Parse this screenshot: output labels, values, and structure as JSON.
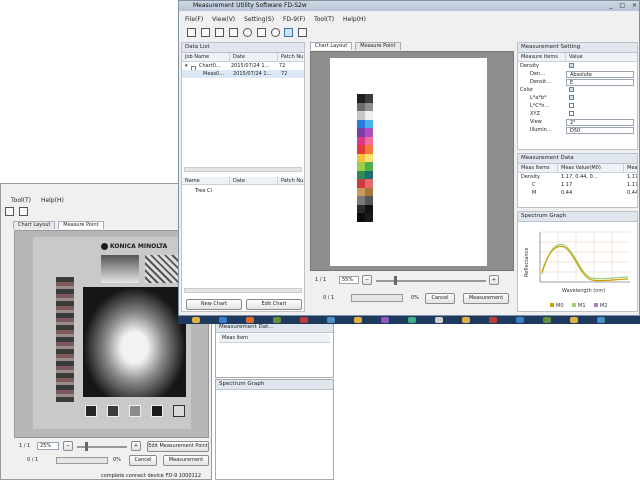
{
  "front_window": {
    "title": "Measurement Utility Software FD-S2w",
    "menu": [
      "File(F)",
      "View(V)",
      "Setting(S)",
      "FD-9(F)",
      "Tool(T)",
      "Help(H)"
    ],
    "toolbar_icons": [
      "new-icon",
      "open-icon",
      "save-icon",
      "search-icon",
      "gear-icon",
      "network-icon",
      "light-icon",
      "graph-icon",
      "panel-icon"
    ],
    "data_list": {
      "title": "Data List",
      "columns": [
        "Job Name",
        "Date",
        "Patch Nu"
      ],
      "rows": [
        {
          "name": "Chart0…",
          "date": "2015/07/24 1…",
          "patches": "72"
        },
        {
          "name": "Meas0…",
          "date": "2015/07/24 1…",
          "patches": "72"
        }
      ],
      "lower_columns": [
        "Name",
        "Date",
        "Patch Nu"
      ],
      "lower_rows": [
        "Tree Cl"
      ],
      "new_chart": "New Chart",
      "edit_chart": "Edit Chart"
    },
    "tabs": [
      "Chart Layout",
      "Measure Point"
    ],
    "zoom": "55%",
    "page": "1 / 1",
    "progress_label": "0 / 1",
    "progress_pct": "0%",
    "cancel": "Cancel",
    "measurement": "Measurement",
    "measurement_setting": {
      "title": "Measurement Setting",
      "columns": [
        "Measure Items",
        "Value"
      ],
      "rows": [
        {
          "label": "Density",
          "value": "",
          "checked": true,
          "group": true
        },
        {
          "label": "Den…",
          "value": "Absolute",
          "select": true
        },
        {
          "label": "Densit…",
          "value": "E",
          "select": true
        },
        {
          "label": "Color",
          "value": "",
          "checked": true,
          "group": true
        },
        {
          "label": "L*a*b*",
          "value": "",
          "checked": true
        },
        {
          "label": "L*C*h…",
          "value": "",
          "checked": false
        },
        {
          "label": "XYZ",
          "value": "",
          "checked": false
        },
        {
          "label": "View",
          "value": "2°",
          "select": true
        },
        {
          "label": "Illumin…",
          "value": "D50",
          "select": true
        }
      ]
    },
    "measurement_data": {
      "title": "Measurement Data",
      "columns": [
        "Meas Items",
        "Meas Value(M0)",
        "Mea"
      ],
      "rows": [
        {
          "label": "Density",
          "value": "1.17, 0.44, 0…",
          "extra": "1.17"
        },
        {
          "label": "C",
          "value": "1.17",
          "extra": "1.17"
        },
        {
          "label": "M",
          "value": "0.44",
          "extra": "0.44"
        }
      ]
    },
    "spectrum_graph": {
      "title": "Spectrum Graph",
      "xlabel": "Wavelength (nm)",
      "ylabel": "Reflectance",
      "legend": [
        "M0",
        "M1",
        "M2"
      ]
    }
  },
  "back_window": {
    "menu": [
      "Tool(T)",
      "Help(H)"
    ],
    "tabs": [
      "Chart Layout",
      "Measure Point"
    ],
    "brand": "KONICA MINOLTA",
    "zoom": "25%",
    "page": "1 / 1",
    "progress_label": "0 / 1",
    "progress_pct": "0%",
    "edit_point": "Edit Measurement Point",
    "cancel": "Cancel",
    "measurement": "Measurement",
    "status": "complete connect device     FD-9 1000112"
  },
  "floating": {
    "measurement_data_title": "Measurement Dat…",
    "meas_item": "Meas Item",
    "spectrum_title": "Spectrum Graph"
  },
  "colors": {
    "accent": "#3a6fb0",
    "taskbar": "#1f3a5f",
    "m0": "#c8a000",
    "m1": "#9fd07a",
    "m2": "#b07acc"
  }
}
